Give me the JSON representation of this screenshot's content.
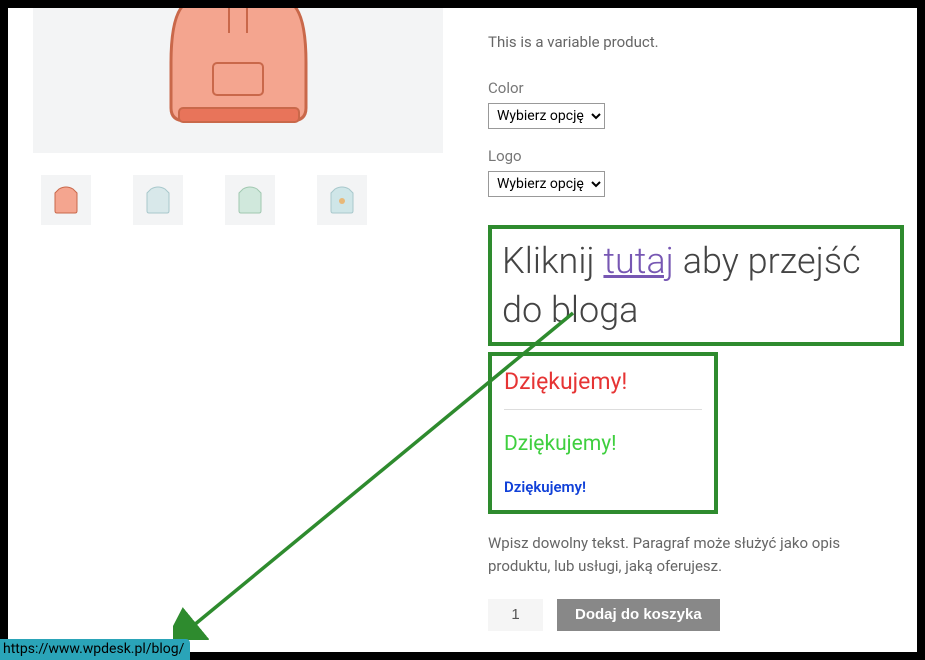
{
  "product": {
    "description": "This is a variable product.",
    "options": {
      "color": {
        "label": "Color",
        "selected": "Wybierz opcję"
      },
      "logo": {
        "label": "Logo",
        "selected": "Wybierz opcję"
      }
    }
  },
  "heading": {
    "before": "Kliknij ",
    "link": "tutaj",
    "after": " aby przejść do bloga",
    "link_url": "https://www.wpdesk.pl/blog/"
  },
  "thanks": {
    "red": "Dziękujemy!",
    "green": "Dziękujemy!",
    "blue": "Dziękujemy!"
  },
  "paragraph": "Wpisz dowolny tekst. Paragraf może służyć jako opis produktu, lub usługi, jaką oferujesz.",
  "cart": {
    "qty": "1",
    "add_label": "Dodaj do koszyka"
  },
  "tooltip_url": "https://www.wpdesk.pl/blog/",
  "colors": {
    "highlight_border": "#2e8b2e",
    "thanks_red": "#e63434",
    "thanks_green": "#3fcf3f",
    "thanks_blue": "#1040d8",
    "link_purple": "#7757b3",
    "tooltip_bg": "#2aa4b8"
  }
}
